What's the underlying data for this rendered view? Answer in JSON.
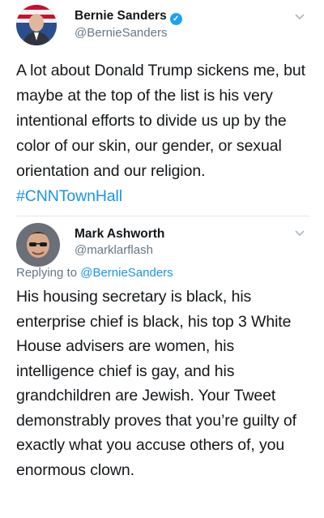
{
  "tweet1": {
    "display_name": "Bernie Sanders",
    "verified": true,
    "handle": "@BernieSanders",
    "body": "A lot about Donald Trump sickens me, but maybe at the top of the list is his very intentional efforts to divide us up by the color of our skin, our gender, or sexual orientation and our religion.",
    "hashtag": "#CNNTownHall"
  },
  "tweet2": {
    "display_name": "Mark Ashworth",
    "handle": "@marklarflash",
    "replying_prefix": "Replying to ",
    "replying_mention": "@BernieSanders",
    "body": "His housing secretary is black, his enterprise chief is black, his top 3 White House advisers are women, his intelligence chief is gay, and his grandchildren are Jewish. Your Tweet demonstrably proves that you’re guilty of exactly what you accuse others of, you enormous clown."
  },
  "colors": {
    "link": "#1b95e0",
    "verified": "#1da1f2",
    "secondary_text": "#657786"
  },
  "icons": {
    "verified": "verified-badge-icon",
    "menu": "chevron-down-icon"
  }
}
